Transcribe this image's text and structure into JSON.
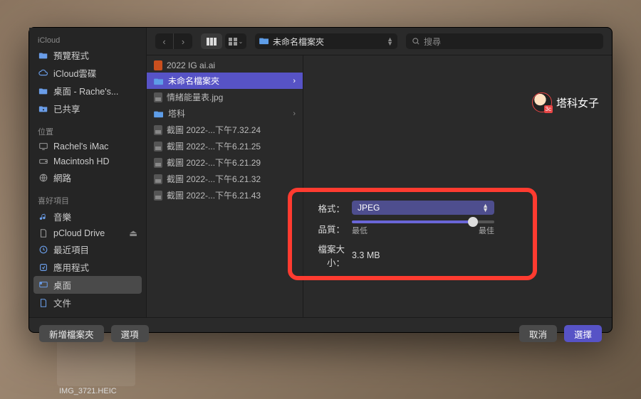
{
  "backdrop": {
    "thumb_label": "IMG_3721.HEIC"
  },
  "sidebar": {
    "sections": [
      {
        "header": "iCloud",
        "items": [
          {
            "icon": "folder",
            "label": "預覽程式"
          },
          {
            "icon": "cloud",
            "label": "iCloud雲碟"
          },
          {
            "icon": "folder",
            "label": "桌面 - Rache's..."
          },
          {
            "icon": "shared",
            "label": "已共享"
          }
        ]
      },
      {
        "header": "位置",
        "items": [
          {
            "icon": "imac",
            "label": "Rachel's iMac"
          },
          {
            "icon": "disk",
            "label": "Macintosh HD"
          },
          {
            "icon": "globe",
            "label": "網路"
          }
        ]
      },
      {
        "header": "喜好項目",
        "items": [
          {
            "icon": "music",
            "label": "音樂"
          },
          {
            "icon": "doc",
            "label": "pCloud Drive",
            "eject": true
          },
          {
            "icon": "clock",
            "label": "最近項目"
          },
          {
            "icon": "app",
            "label": "應用程式"
          },
          {
            "icon": "desktop",
            "label": "桌面",
            "selected": true
          },
          {
            "icon": "doc",
            "label": "文件"
          }
        ]
      }
    ]
  },
  "toolbar": {
    "path_label": "未命名檔案夾",
    "search_placeholder": "搜尋"
  },
  "files": [
    {
      "type": "ai",
      "name": "2022 IG ai.ai"
    },
    {
      "type": "folder",
      "name": "未命名檔案夾",
      "chevron": true,
      "selected": true
    },
    {
      "type": "img",
      "name": "情緒能量表.jpg"
    },
    {
      "type": "folder",
      "name": "塔科",
      "chevron": true
    },
    {
      "type": "img",
      "name": "截圖 2022-...下午7.32.24"
    },
    {
      "type": "img",
      "name": "截圖 2022-...下午6.21.25"
    },
    {
      "type": "img",
      "name": "截圖 2022-...下午6.21.29"
    },
    {
      "type": "img",
      "name": "截圖 2022-...下午6.21.32"
    },
    {
      "type": "img",
      "name": "截圖 2022-...下午6.21.43"
    }
  ],
  "watermark": {
    "text": "塔科女子"
  },
  "options": {
    "format_label": "格式：",
    "format_value": "JPEG",
    "quality_label": "品質：",
    "quality_min": "最低",
    "quality_max": "最佳",
    "filesize_label": "檔案大小：",
    "filesize_value": "3.3 MB"
  },
  "footer": {
    "new_folder": "新增檔案夾",
    "options": "選項",
    "cancel": "取消",
    "choose": "選擇"
  }
}
